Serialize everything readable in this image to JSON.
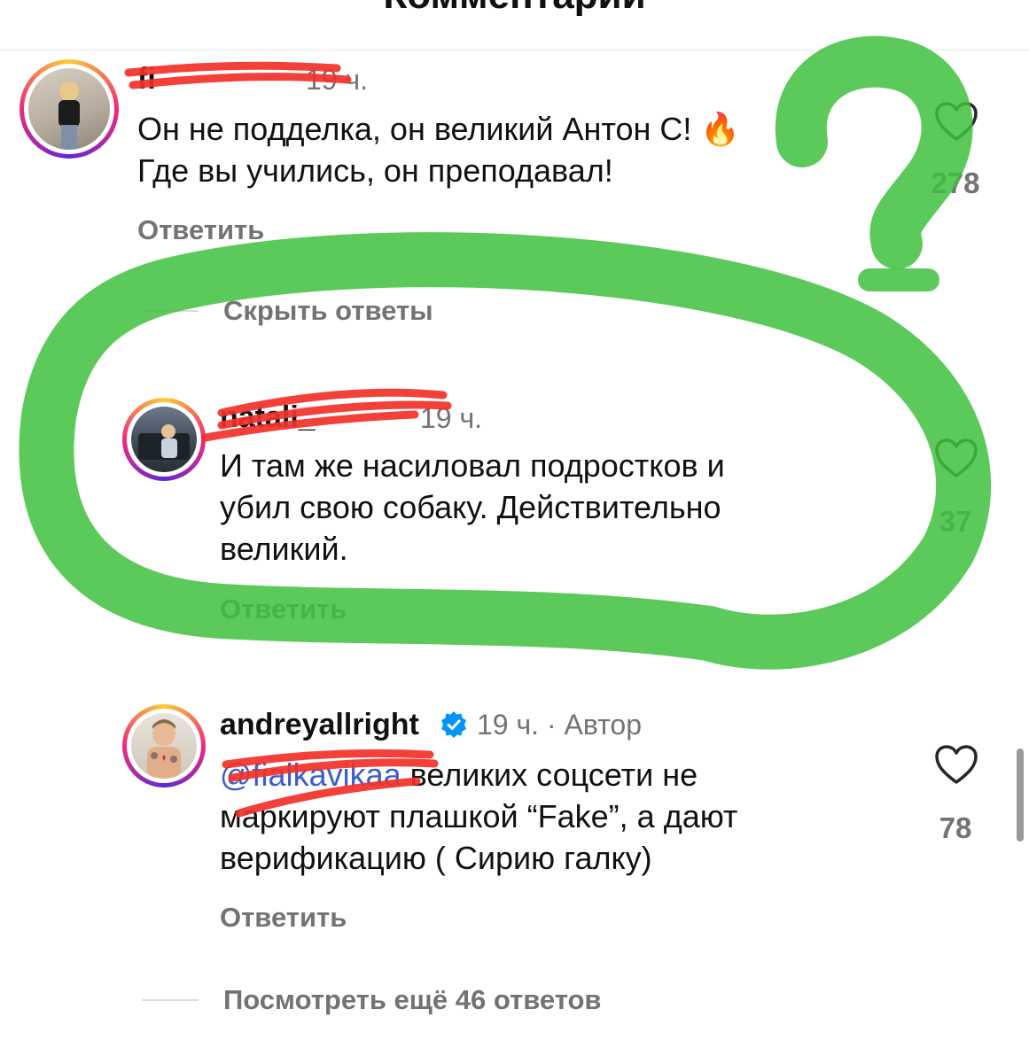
{
  "header": {
    "title": "Комментарии"
  },
  "comments": [
    {
      "username": "fi",
      "time": "19 ч.",
      "text_lines": [
        "Он не подделка, он великий Антон С! 🔥",
        "Где вы учились, он преподавал!"
      ],
      "reply_label": "Ответить",
      "likes": "278"
    },
    {
      "username": "natali_",
      "time": "19 ч.",
      "text_lines": [
        "И там же насиловал подростков и",
        "убил свою собаку. Действительно",
        "великий."
      ],
      "reply_label": "Ответить",
      "likes": "37"
    },
    {
      "username": "andreyallright",
      "meta": "19 ч. · Автор",
      "mention": "@fialkavikaa",
      "text_line1_rest": " великих соцсети не",
      "text_lines_rest": [
        "маркируют плашкой “Fake”, а дают",
        "верификацию ( Сирию галку)"
      ],
      "reply_label": "Ответить",
      "likes": "78"
    }
  ],
  "threads": {
    "hide_replies": "Скрыть ответы",
    "view_more": "Посмотреть ещё 46 ответов"
  },
  "colors": {
    "green_marker": "#3ec13e",
    "red_scribble": "#f2312a",
    "verified": "#0095f6",
    "muted": "#737373"
  }
}
